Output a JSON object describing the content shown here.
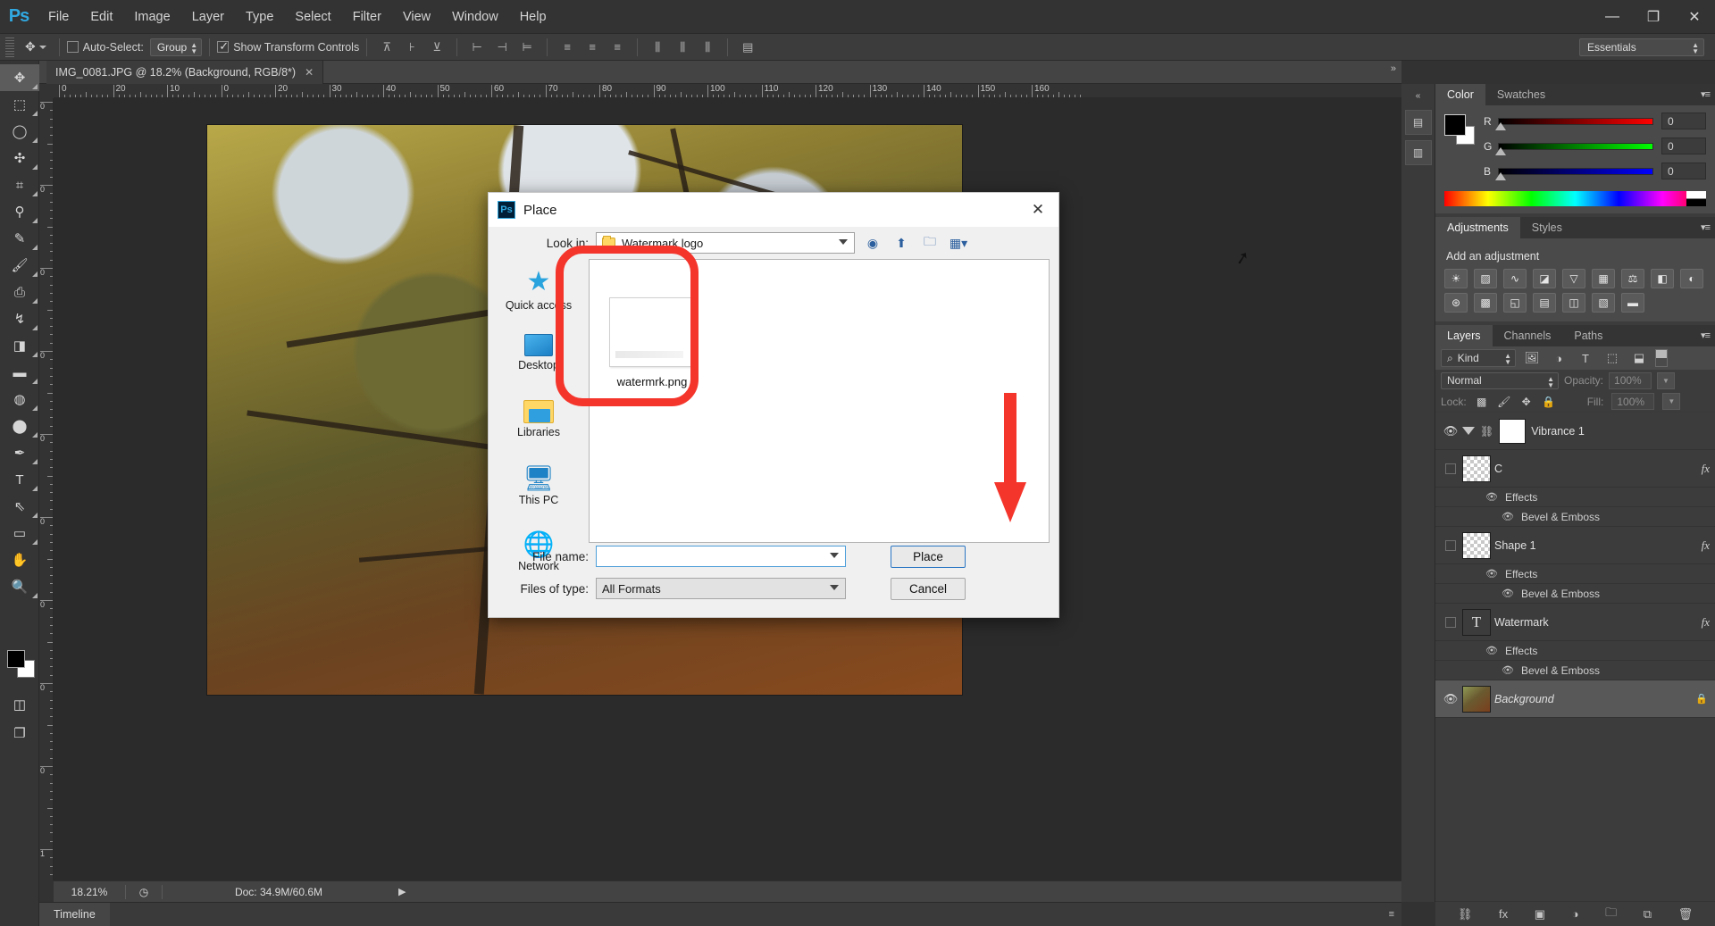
{
  "app": {
    "name": "Ps",
    "logo_text": "Ps"
  },
  "menubar": {
    "items": [
      "File",
      "Edit",
      "Image",
      "Layer",
      "Type",
      "Select",
      "Filter",
      "View",
      "Window",
      "Help"
    ],
    "window_controls": {
      "minimize": "—",
      "restore": "❐",
      "close": "✕"
    }
  },
  "options_bar": {
    "tool_icon": "move-tool-icon",
    "auto_select_label": "Auto-Select:",
    "auto_select_checked": false,
    "group_value": "Group",
    "show_transform_label": "Show Transform Controls",
    "show_transform_checked": true,
    "align_buttons": [
      "align-top-edges",
      "align-vertical-centers",
      "align-bottom-edges",
      "align-left-edges",
      "align-horizontal-centers",
      "align-right-edges",
      "distribute-top-edges",
      "distribute-vertical-centers",
      "distribute-bottom-edges",
      "distribute-left-edges",
      "distribute-horizontal-centers",
      "distribute-right-edges",
      "auto-align-layers"
    ],
    "workspace": "Essentials"
  },
  "toolbar": {
    "tools": [
      "move-tool",
      "rectangular-marquee-tool",
      "lasso-tool",
      "quick-selection-tool",
      "crop-tool",
      "eyedropper-tool",
      "spot-healing-brush-tool",
      "brush-tool",
      "clone-stamp-tool",
      "history-brush-tool",
      "eraser-tool",
      "gradient-tool",
      "blur-tool",
      "dodge-tool",
      "pen-tool",
      "horizontal-type-tool",
      "path-selection-tool",
      "rectangle-tool",
      "hand-tool",
      "zoom-tool"
    ],
    "foreground_color": "#000000",
    "background_color": "#ffffff",
    "quick_mask": "edit-in-quick-mask-mode",
    "screen_mode": "change-screen-mode"
  },
  "document": {
    "tab_title": "IMG_0081.JPG @ 18.2% (Background, RGB/8*)",
    "tab_close": "✕"
  },
  "rulers": {
    "horizontal_labels": [
      "0",
      "20",
      "10",
      "0",
      "20",
      "30",
      "40",
      "50",
      "60",
      "70",
      "80",
      "90",
      "100",
      "110",
      "120",
      "130",
      "140",
      "150",
      "160"
    ],
    "vertical_labels": [
      "0",
      "0",
      "0",
      "0",
      "0",
      "0",
      "0",
      "0",
      "0",
      "1"
    ]
  },
  "status_bar": {
    "zoom": "18.21%",
    "doc_info": "Doc: 34.9M/60.6M",
    "expand_arrow": "▶"
  },
  "timeline": {
    "tab_label": "Timeline"
  },
  "dialog": {
    "title": "Place",
    "app_icon": "photoshop-icon",
    "close_label": "✕",
    "look_in_label": "Look in:",
    "look_in_value": "Watermark logo",
    "nav_buttons": [
      "back-button",
      "up-one-level-button",
      "create-new-folder-button",
      "view-menu-button"
    ],
    "places": [
      {
        "label": "Quick access",
        "icon": "quick-access-star-icon"
      },
      {
        "label": "Desktop",
        "icon": "desktop-monitor-icon"
      },
      {
        "label": "Libraries",
        "icon": "libraries-folder-icon"
      },
      {
        "label": "This PC",
        "icon": "this-pc-icon"
      },
      {
        "label": "Network",
        "icon": "network-globe-icon"
      }
    ],
    "files": [
      {
        "name": "watermrk.png",
        "icon": "image-file-thumbnail"
      }
    ],
    "file_name_label": "File name:",
    "file_name_value": "",
    "files_of_type_label": "Files of type:",
    "files_of_type_value": "All Formats",
    "place_button": "Place",
    "cancel_button": "Cancel"
  },
  "annotations": {
    "highlight_color": "#f4352c",
    "arrow": "red-down-arrow",
    "ring": "red-rounded-rectangle-highlight"
  },
  "panels": {
    "color": {
      "tabs": [
        "Color",
        "Swatches"
      ],
      "active_tab": "Color",
      "channels": [
        {
          "label": "R",
          "value": "0"
        },
        {
          "label": "G",
          "value": "0"
        },
        {
          "label": "B",
          "value": "0"
        }
      ]
    },
    "adjustments": {
      "tabs": [
        "Adjustments",
        "Styles"
      ],
      "active_tab": "Adjustments",
      "heading": "Add an adjustment",
      "icons": [
        "brightness-contrast-icon",
        "levels-icon",
        "curves-icon",
        "exposure-icon",
        "vibrance-icon",
        "hue-saturation-icon",
        "color-balance-icon",
        "black-white-icon",
        "photo-filter-icon",
        "channel-mixer-icon",
        "color-lookup-icon",
        "invert-icon",
        "posterize-icon",
        "threshold-icon",
        "gradient-map-icon",
        "selective-color-icon"
      ]
    },
    "layers": {
      "tabs": [
        "Layers",
        "Channels",
        "Paths"
      ],
      "active_tab": "Layers",
      "filter_kind": "Kind",
      "filter_icons": [
        "pixel-layers-filter-icon",
        "adjustment-layers-filter-icon",
        "type-layers-filter-icon",
        "shape-layers-filter-icon",
        "smart-object-filter-icon"
      ],
      "blend_mode": "Normal",
      "opacity_label": "Opacity:",
      "opacity_value": "100%",
      "lock_label": "Lock:",
      "lock_icons": [
        "lock-transparent-pixels-icon",
        "lock-image-pixels-icon",
        "lock-position-icon",
        "lock-all-icon"
      ],
      "fill_label": "Fill:",
      "fill_value": "100%",
      "rows": [
        {
          "name": "Vibrance 1",
          "type": "adjustment",
          "visible": true,
          "selected": false,
          "has_fx": false,
          "locked": false
        },
        {
          "name": "C",
          "type": "shape",
          "visible": false,
          "selected": false,
          "has_fx": true,
          "locked": false,
          "children": [
            {
              "label": "Effects"
            },
            {
              "label": "Bevel & Emboss"
            }
          ]
        },
        {
          "name": "Shape 1",
          "type": "shape",
          "visible": false,
          "selected": false,
          "has_fx": true,
          "locked": false,
          "children": [
            {
              "label": "Effects"
            },
            {
              "label": "Bevel & Emboss"
            }
          ]
        },
        {
          "name": "Watermark",
          "type": "type",
          "visible": false,
          "selected": false,
          "has_fx": true,
          "locked": false,
          "children": [
            {
              "label": "Effects"
            },
            {
              "label": "Bevel & Emboss"
            }
          ]
        },
        {
          "name": "Background",
          "type": "image",
          "visible": true,
          "selected": true,
          "has_fx": false,
          "locked": true
        }
      ],
      "bottom_icons": [
        "link-layers-icon",
        "add-layer-style-icon",
        "add-layer-mask-icon",
        "create-adjustment-layer-icon",
        "create-group-icon",
        "create-new-layer-icon",
        "delete-layer-icon"
      ]
    }
  }
}
